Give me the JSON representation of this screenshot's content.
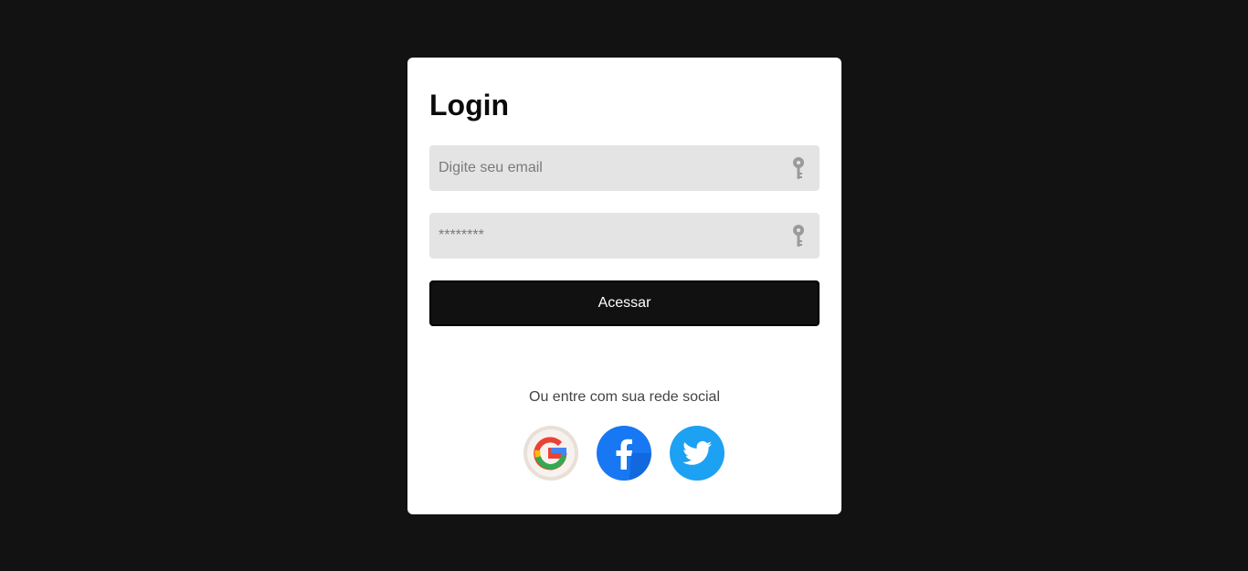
{
  "login": {
    "title": "Login",
    "email_placeholder": "Digite seu email",
    "password_placeholder": "********",
    "submit_label": "Acessar",
    "social_text": "Ou entre com sua rede social",
    "email_icon": "key-icon",
    "password_icon": "key-icon",
    "social": [
      {
        "name": "google-icon",
        "color": "#ea4335"
      },
      {
        "name": "facebook-icon",
        "color": "#1877f2"
      },
      {
        "name": "twitter-icon",
        "color": "#1da1f2"
      }
    ]
  }
}
